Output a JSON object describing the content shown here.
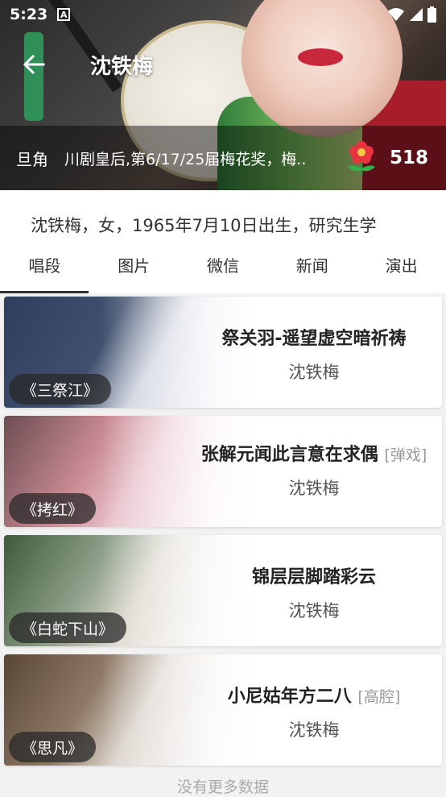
{
  "status_bar": {
    "time": "5:23",
    "notification_letter": "A"
  },
  "header": {
    "title": "沈铁梅",
    "role": "旦角",
    "honors": "川剧皇后,第6/17/25届梅花奖，梅..",
    "likes": "518"
  },
  "bio": "沈铁梅，女，1965年7月10日出生，研究生学",
  "tabs": [
    "唱段",
    "图片",
    "微信",
    "新闻",
    "演出"
  ],
  "active_tab": 0,
  "songs": [
    {
      "opera": "《三祭江》",
      "title": "祭关羽-遥望虚空暗祈祷",
      "tag": "",
      "artist": "沈铁梅"
    },
    {
      "opera": "《拷红》",
      "title": "张解元闻此言意在求偶",
      "tag": "[弹戏]",
      "artist": "沈铁梅"
    },
    {
      "opera": "《白蛇下山》",
      "title": "锦层层脚踏彩云",
      "tag": "",
      "artist": "沈铁梅"
    },
    {
      "opera": "《思凡》",
      "title": "小尼姑年方二八",
      "tag": "[高腔]",
      "artist": "沈铁梅"
    }
  ],
  "footer_text": "没有更多数据",
  "colors": {
    "accent": "#333333",
    "flower": "#e8343f"
  }
}
